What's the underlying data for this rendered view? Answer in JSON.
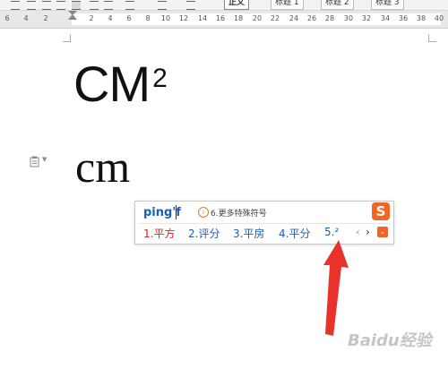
{
  "toolbar": {
    "styles": [
      "正文",
      "标题 1",
      "标题 2",
      "标题 3"
    ]
  },
  "ruler": {
    "ticks": [
      "6",
      "4",
      "2",
      "2",
      "4",
      "6",
      "8",
      "10",
      "12",
      "14",
      "16",
      "18",
      "20",
      "22",
      "24",
      "26",
      "28",
      "30",
      "32",
      "34",
      "36",
      "38",
      "40"
    ]
  },
  "document": {
    "line1_base": "CM",
    "line1_sup": "2",
    "line2": "cm"
  },
  "ime": {
    "input": "ping'f",
    "hint_icon": "i",
    "hint": "6.更多特殊符号",
    "logo": "S",
    "candidates": [
      "1.平方",
      "2.评分",
      "3.平房",
      "4.平分",
      "5.²"
    ],
    "nav_prev": "‹",
    "nav_next": "›",
    "expand": "⌄"
  },
  "watermark": {
    "text": "Baidu经验"
  },
  "colors": {
    "ime_accent": "#f26522",
    "candidate_blue": "#1a5fb4",
    "candidate_selected": "#e02020",
    "arrow": "#e8322b"
  }
}
